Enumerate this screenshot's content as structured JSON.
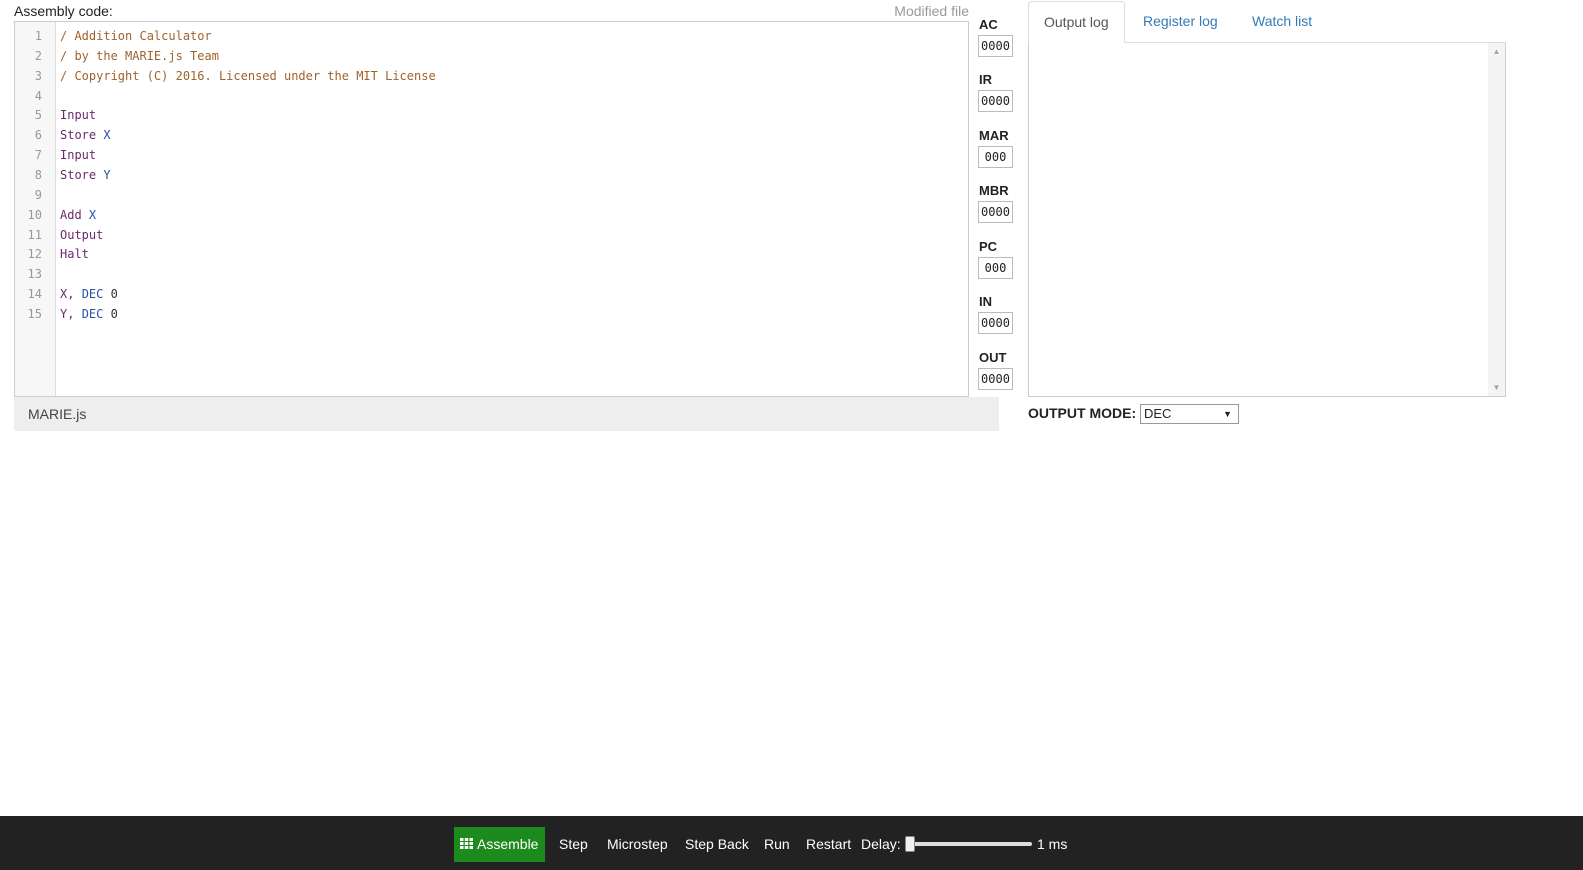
{
  "editor": {
    "label": "Assembly code:",
    "modified_label": "Modified file",
    "lines": [
      {
        "num": "1",
        "tokens": [
          {
            "t": "/ Addition Calculator",
            "c": "comment"
          }
        ]
      },
      {
        "num": "2",
        "tokens": [
          {
            "t": "/ by the MARIE.js Team",
            "c": "comment"
          }
        ]
      },
      {
        "num": "3",
        "tokens": [
          {
            "t": "/ Copyright (C) 2016. Licensed under the MIT License",
            "c": "comment"
          }
        ]
      },
      {
        "num": "4",
        "tokens": []
      },
      {
        "num": "5",
        "tokens": [
          {
            "t": "Input",
            "c": "keyword"
          }
        ]
      },
      {
        "num": "6",
        "tokens": [
          {
            "t": "Store ",
            "c": "keyword"
          },
          {
            "t": "X",
            "c": "var"
          }
        ]
      },
      {
        "num": "7",
        "tokens": [
          {
            "t": "Input",
            "c": "keyword"
          }
        ]
      },
      {
        "num": "8",
        "tokens": [
          {
            "t": "Store ",
            "c": "keyword"
          },
          {
            "t": "Y",
            "c": "var"
          }
        ]
      },
      {
        "num": "9",
        "tokens": []
      },
      {
        "num": "10",
        "tokens": [
          {
            "t": "Add ",
            "c": "keyword"
          },
          {
            "t": "X",
            "c": "var"
          }
        ]
      },
      {
        "num": "11",
        "tokens": [
          {
            "t": "Output",
            "c": "keyword"
          }
        ]
      },
      {
        "num": "12",
        "tokens": [
          {
            "t": "Halt",
            "c": "keyword"
          }
        ]
      },
      {
        "num": "13",
        "tokens": []
      },
      {
        "num": "14",
        "tokens": [
          {
            "t": "X, ",
            "c": "keyword"
          },
          {
            "t": "DEC",
            "c": "var"
          },
          {
            "t": " 0",
            "c": "num"
          }
        ]
      },
      {
        "num": "15",
        "tokens": [
          {
            "t": "Y, ",
            "c": "keyword"
          },
          {
            "t": "DEC",
            "c": "var"
          },
          {
            "t": " 0",
            "c": "num"
          }
        ]
      }
    ]
  },
  "status_bar": {
    "text": "MARIE.js"
  },
  "registers": [
    {
      "name": "AC",
      "value": "0000"
    },
    {
      "name": "IR",
      "value": "0000"
    },
    {
      "name": "MAR",
      "value": "000"
    },
    {
      "name": "MBR",
      "value": "0000"
    },
    {
      "name": "PC",
      "value": "000"
    },
    {
      "name": "IN",
      "value": "0000"
    },
    {
      "name": "OUT",
      "value": "0000"
    }
  ],
  "tabs": {
    "output_log": "Output log",
    "register_log": "Register log",
    "watch_list": "Watch list"
  },
  "output_mode": {
    "label": "OUTPUT MODE:",
    "selected": "DEC"
  },
  "toolbar": {
    "assemble": "Assemble",
    "step": "Step",
    "microstep": "Microstep",
    "step_back": "Step Back",
    "run": "Run",
    "restart": "Restart",
    "delay_label": "Delay:",
    "delay_value": "1 ms"
  },
  "colors": {
    "assemble_bg": "#1c8a1c",
    "toolbar_bg": "#222222",
    "tab_link": "#337ab7",
    "comment": "#a0622d",
    "keyword": "#6b2a6b",
    "variable": "#2b4fa8"
  }
}
